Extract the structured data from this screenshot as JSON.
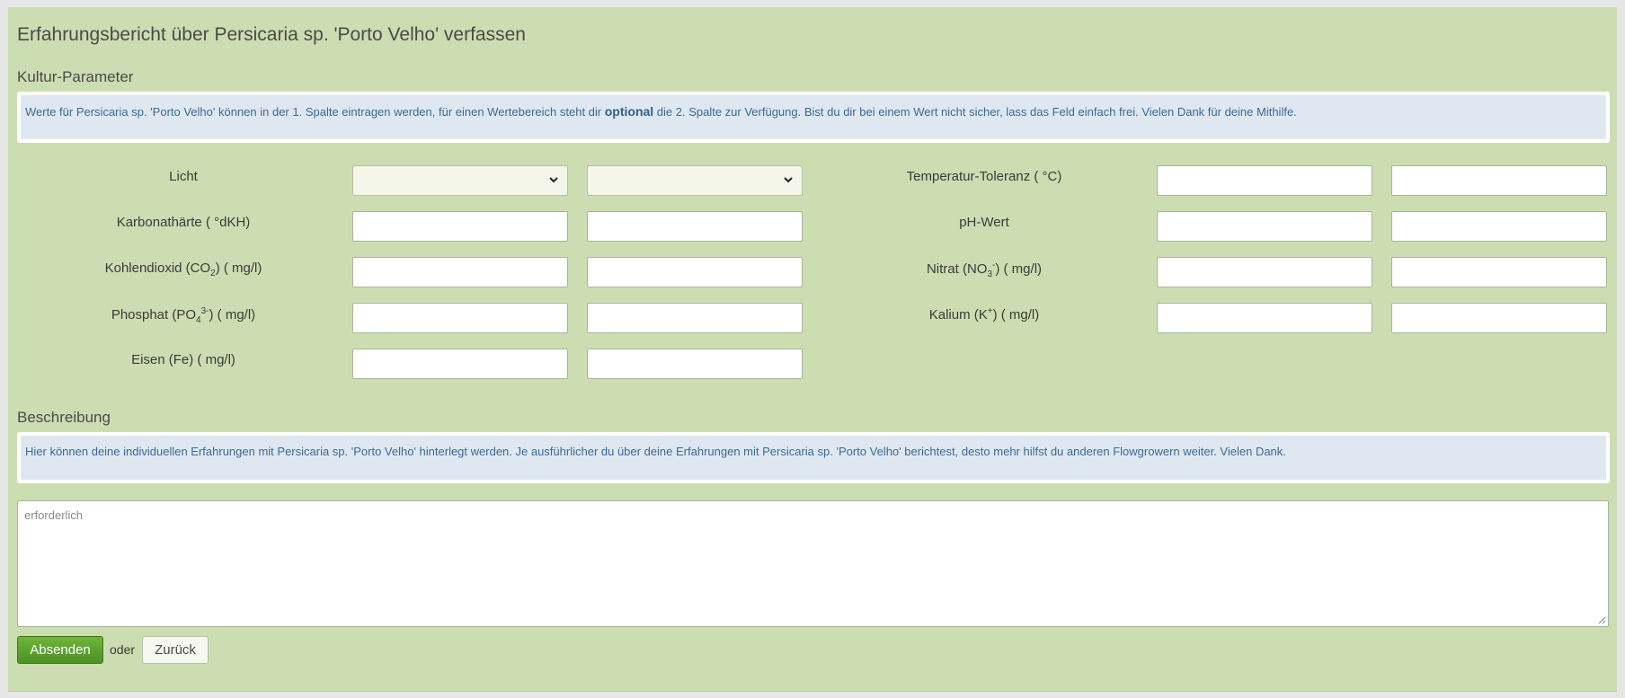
{
  "page_title": "Erfahrungsbericht über Persicaria sp. 'Porto Velho' verfassen",
  "kultur": {
    "title": "Kultur-Parameter",
    "info_pre": "Werte für Persicaria sp. 'Porto Velho' können in der 1. Spalte eintragen werden, für einen Wertebereich steht dir ",
    "info_bold": "optional",
    "info_post": " die 2. Spalte zur Verfügung. Bist du dir bei einem Wert nicht sicher, lass das Feld einfach frei. Vielen Dank für deine Mithilfe.",
    "fields": {
      "licht": {
        "label": "Licht",
        "value1": "",
        "value2": ""
      },
      "temperatur": {
        "label": "Temperatur-Toleranz ( °C)",
        "value1": "",
        "value2": ""
      },
      "karbonat": {
        "label": "Karbonathärte ( °dKH)",
        "value1": "",
        "value2": ""
      },
      "ph": {
        "label": "pH-Wert",
        "value1": "",
        "value2": ""
      },
      "co2": {
        "label_pre": "Kohlendioxid (CO",
        "label_sub": "2",
        "label_post": ") ( mg/l)",
        "value1": "",
        "value2": ""
      },
      "nitrat": {
        "label_pre": "Nitrat (NO",
        "label_sub": "3",
        "label_sup": "-",
        "label_post": ") ( mg/l)",
        "value1": "",
        "value2": ""
      },
      "phosphat": {
        "label_pre": "Phosphat (PO",
        "label_sub": "4",
        "label_sup": "3-",
        "label_post": ") ( mg/l)",
        "value1": "",
        "value2": ""
      },
      "kalium": {
        "label_pre": "Kalium (K",
        "label_sup": "+",
        "label_post": ") ( mg/l)",
        "value1": "",
        "value2": ""
      },
      "eisen": {
        "label": "Eisen (Fe) ( mg/l)",
        "value1": "",
        "value2": ""
      }
    }
  },
  "beschreibung": {
    "title": "Beschreibung",
    "info": "Hier können deine individuellen Erfahrungen mit Persicaria sp. 'Porto Velho' hinterlegt werden. Je ausführlicher du über deine Erfahrungen mit Persicaria sp. 'Porto Velho' berichtest, desto mehr hilfst du anderen Flowgrowern weiter. Vielen Dank.",
    "placeholder": "erforderlich",
    "value": ""
  },
  "actions": {
    "submit_label": "Absenden",
    "or_label": "oder",
    "back_label": "Zurück"
  },
  "colors": {
    "panel_bg": "#ccdeb1",
    "info_bg": "#dfe8f0",
    "info_text": "#3a6a9a",
    "submit_green": "#5aa12e"
  }
}
